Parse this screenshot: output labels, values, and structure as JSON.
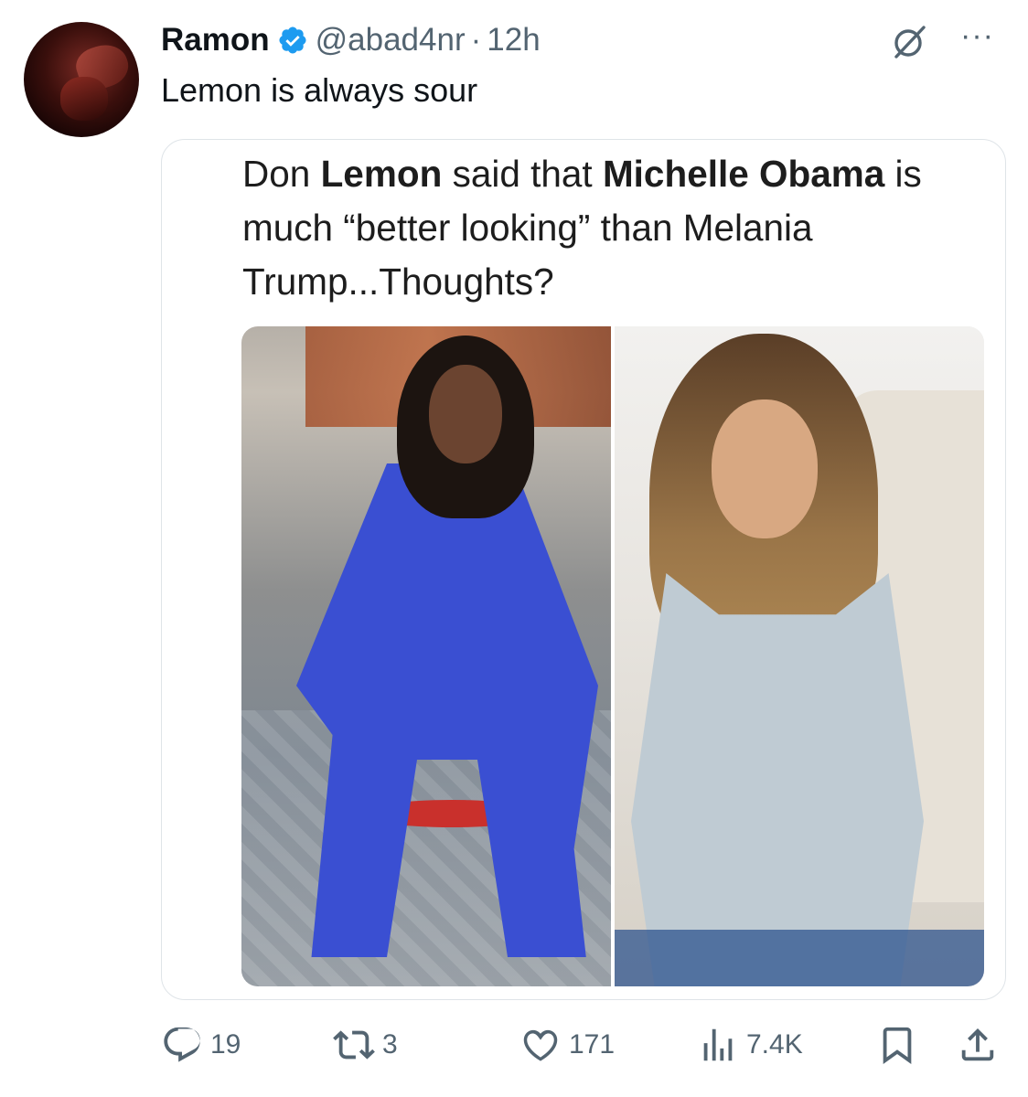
{
  "tweet": {
    "author_name": "Ramon",
    "handle": "@abad4nr",
    "separator": "·",
    "time": "12h",
    "text": "Lemon is always sour"
  },
  "quoted_media": {
    "text_parts": [
      {
        "t": "Don ",
        "bold": false
      },
      {
        "t": "Lemon",
        "bold": true
      },
      {
        "t": " said that ",
        "bold": false
      },
      {
        "t": "Michelle Obama",
        "bold": true
      },
      {
        "t": " is much “better looking” than Melania Trump...Thoughts?",
        "bold": false
      }
    ]
  },
  "actions": {
    "replies": "19",
    "reposts": "3",
    "likes": "171",
    "views": "7.4K"
  },
  "colors": {
    "verified": "#1d9bf0",
    "secondary_text": "#536471",
    "primary_text": "#0f1419"
  },
  "icons": [
    "verified-badge-icon",
    "grok-icon",
    "more-icon",
    "reply-icon",
    "repost-icon",
    "like-icon",
    "views-icon",
    "bookmark-icon",
    "share-icon"
  ]
}
